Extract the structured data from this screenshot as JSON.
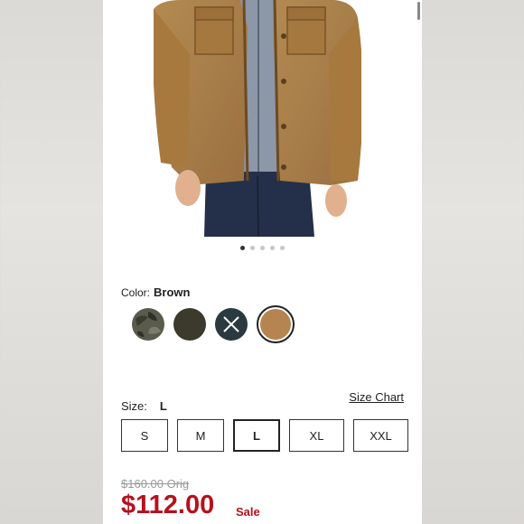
{
  "carousel": {
    "slide_count": 5,
    "active_index": 0
  },
  "color": {
    "label": "Color:",
    "selected_value": "Brown",
    "swatches": [
      {
        "name": "Camo",
        "color": "#4f4f42",
        "available": true
      },
      {
        "name": "Olive",
        "color": "#3c3a2c",
        "available": true
      },
      {
        "name": "Navy",
        "color": "#2b3a40",
        "available": false
      },
      {
        "name": "Brown",
        "color": "#b58450",
        "available": true,
        "selected": true
      }
    ]
  },
  "size": {
    "label": "Size:",
    "selected_value": "L",
    "chart_link": "Size Chart",
    "options": [
      "S",
      "M",
      "L",
      "XL",
      "XXL"
    ]
  },
  "price": {
    "original": "$160.00 Orig",
    "sale": "$112.00",
    "sale_tag": "Sale"
  },
  "colors": {
    "sale_red": "#b6111c"
  }
}
